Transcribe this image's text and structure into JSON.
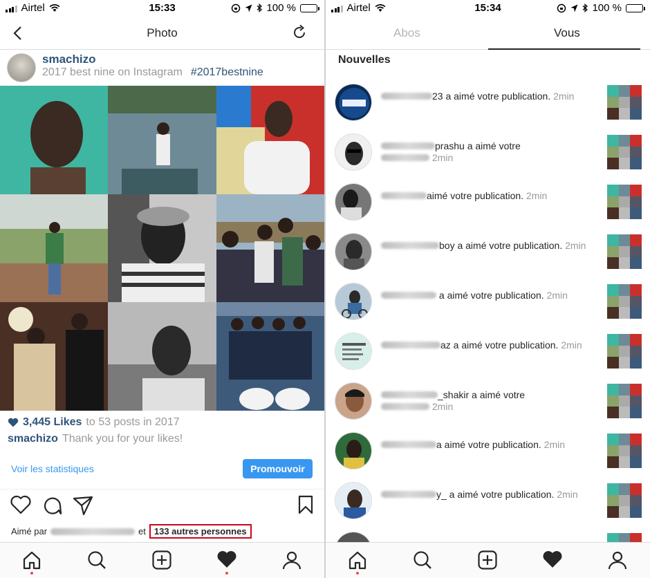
{
  "left": {
    "status": {
      "carrier": "Airtel",
      "time": "15:33",
      "battery": "100 %"
    },
    "header": {
      "title": "Photo"
    },
    "post": {
      "username": "smachizo",
      "subtitle": "2017 best nine on Instagram",
      "hashtag": "#2017bestnine",
      "likes_count": "3,445 Likes",
      "likes_suffix": "to 53 posts in 2017",
      "caption_user": "smachizo",
      "caption_text": "Thank you for your likes!"
    },
    "insights": {
      "link": "Voir les statistiques",
      "promote": "Promouvoir"
    },
    "liked_by": {
      "prefix": "Aimé par",
      "connector": "et",
      "others": "133 autres personnes"
    }
  },
  "right": {
    "status": {
      "carrier": "Airtel",
      "time": "15:34",
      "battery": "100 %"
    },
    "tabs": {
      "following": "Abos",
      "you": "Vous"
    },
    "section_title": "Nouvelles",
    "notifications": [
      {
        "name_visible": "23",
        "text": " a aimé votre publication.",
        "time": "2min",
        "sub": ""
      },
      {
        "name_visible": "prashu",
        "text": " a aimé votre",
        "time": "2min",
        "sub": ""
      },
      {
        "name_visible": "",
        "text": "aimé votre publication.",
        "time": "2min",
        "sub": ""
      },
      {
        "name_visible": "boy",
        "text": " a aimé votre publication.",
        "time": "2min",
        "sub": ""
      },
      {
        "name_visible": "",
        "text": " a aimé votre publication.",
        "time": "2min",
        "sub": ""
      },
      {
        "name_visible": "az",
        "text": " a aimé votre publication.",
        "time": "2min",
        "sub": ""
      },
      {
        "name_visible": "_shakir",
        "text": " a aimé votre",
        "time": "2min",
        "sub": ""
      },
      {
        "name_visible": "a",
        "text": " aimé votre publication.",
        "time": "2min",
        "sub": ""
      },
      {
        "name_visible": "y_",
        "text": " a aimé votre publication.",
        "time": "2min",
        "sub": ""
      }
    ]
  },
  "colors": {
    "link_blue": "#3897f0",
    "username_blue": "#2d5478",
    "highlight_red": "#d0021b",
    "battery_yellow": "#f4c61d"
  },
  "icons": [
    "back-icon",
    "refresh-icon",
    "heart-icon",
    "comment-icon",
    "share-icon",
    "bookmark-icon",
    "home-icon",
    "search-icon",
    "add-icon",
    "activity-heart-icon",
    "profile-icon"
  ]
}
